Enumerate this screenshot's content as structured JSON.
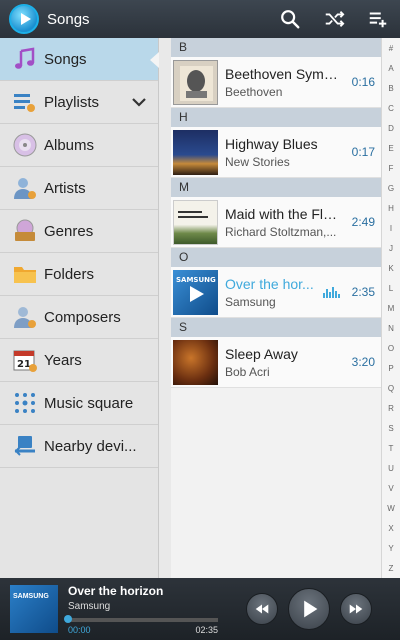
{
  "app": {
    "title": "Songs"
  },
  "sidebar": {
    "items": [
      {
        "label": "Songs",
        "icon": "music-note-icon",
        "active": true
      },
      {
        "label": "Playlists",
        "icon": "playlist-icon",
        "expandable": true
      },
      {
        "label": "Albums",
        "icon": "disc-icon"
      },
      {
        "label": "Artists",
        "icon": "person-icon"
      },
      {
        "label": "Genres",
        "icon": "genre-icon"
      },
      {
        "label": "Folders",
        "icon": "folder-icon"
      },
      {
        "label": "Composers",
        "icon": "composer-icon"
      },
      {
        "label": "Years",
        "icon": "calendar-icon"
      },
      {
        "label": "Music square",
        "icon": "grid-icon"
      },
      {
        "label": "Nearby devi...",
        "icon": "nearby-devices-icon"
      }
    ]
  },
  "songs": {
    "sections": [
      {
        "letter": "B",
        "title": "Beethoven Symp...",
        "artist": "Beethoven",
        "duration": "0:16"
      },
      {
        "letter": "H",
        "title": "Highway Blues",
        "artist": "New Stories",
        "duration": "0:17"
      },
      {
        "letter": "M",
        "title": "Maid with the Fla...",
        "artist": "Richard Stoltzman,...",
        "duration": "2:49"
      },
      {
        "letter": "O",
        "title": "Over the hor...",
        "artist": "Samsung",
        "duration": "2:35",
        "playing": true
      },
      {
        "letter": "S",
        "title": "Sleep Away",
        "artist": "Bob Acri",
        "duration": "3:20"
      }
    ]
  },
  "index": [
    "#",
    "A",
    "B",
    "C",
    "D",
    "E",
    "F",
    "G",
    "H",
    "I",
    "J",
    "K",
    "L",
    "M",
    "N",
    "O",
    "P",
    "Q",
    "R",
    "S",
    "T",
    "U",
    "V",
    "W",
    "X",
    "Y",
    "Z"
  ],
  "player": {
    "title": "Over the horizon",
    "artist": "Samsung",
    "current_time": "00:00",
    "total_time": "02:35",
    "progress": 0.0,
    "thumb_brand": "SAMSUNG"
  },
  "colors": {
    "accent": "#3fa9dc",
    "topbar": "#353d46",
    "section": "#c7d1db"
  }
}
